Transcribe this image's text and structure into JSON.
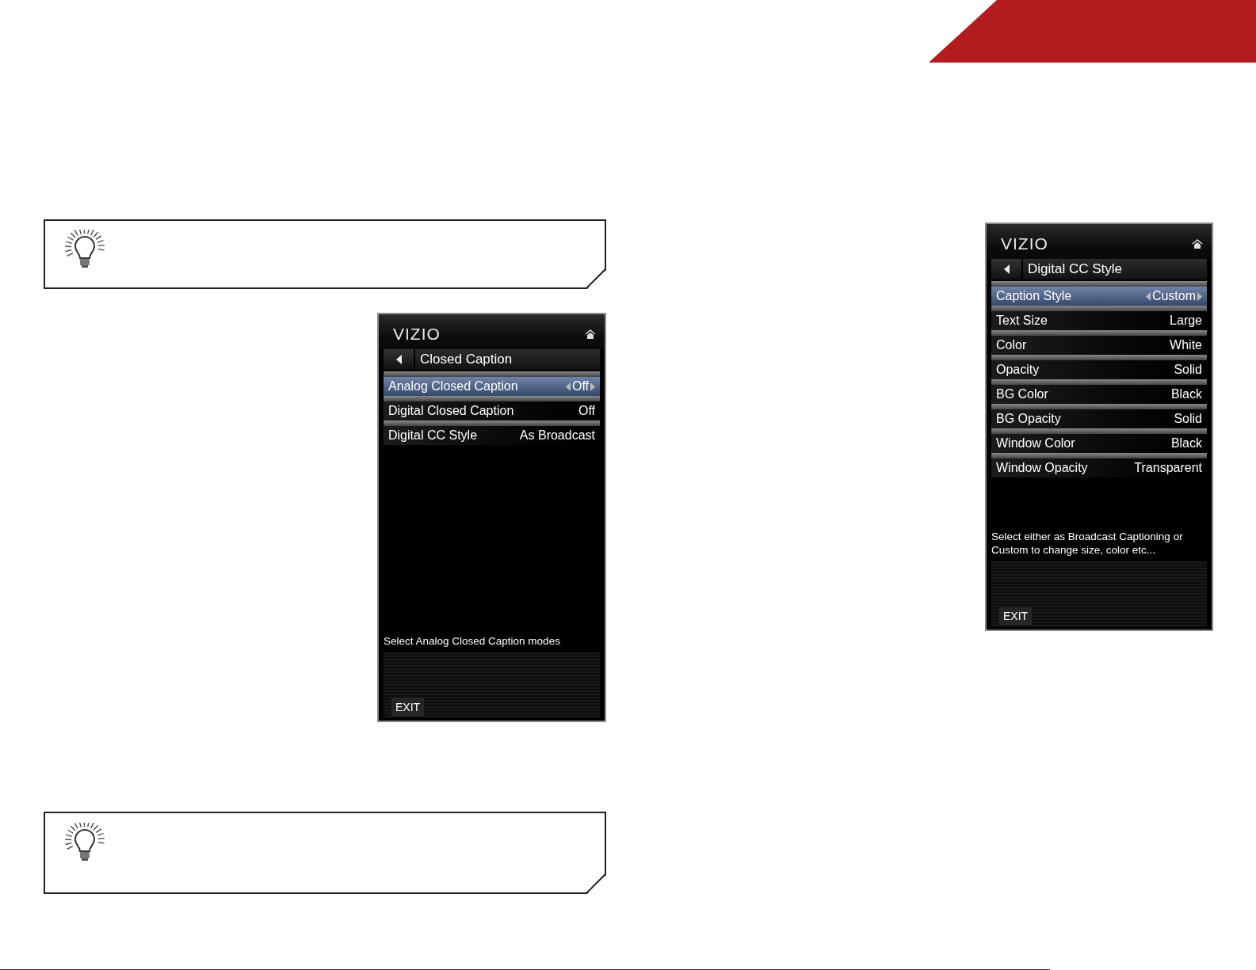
{
  "screens": [
    {
      "logo": "VIZIO",
      "title": "Closed Caption",
      "items": [
        {
          "label": "Analog Closed Caption",
          "value": "Off",
          "selected": true
        },
        {
          "label": "Digital Closed Caption",
          "value": "Off",
          "selected": false
        },
        {
          "label": "Digital CC Style",
          "value": "As Broadcast",
          "selected": false
        }
      ],
      "help": "Select Analog Closed Caption modes",
      "exit": "EXIT"
    },
    {
      "logo": "VIZIO",
      "title": "Digital CC Style",
      "items": [
        {
          "label": "Caption Style",
          "value": "Custom",
          "selected": true
        },
        {
          "label": "Text Size",
          "value": "Large",
          "selected": false
        },
        {
          "label": "Color",
          "value": "White",
          "selected": false
        },
        {
          "label": "Opacity",
          "value": "Solid",
          "selected": false
        },
        {
          "label": "BG Color",
          "value": "Black",
          "selected": false
        },
        {
          "label": "BG Opacity",
          "value": "Solid",
          "selected": false
        },
        {
          "label": "Window Color",
          "value": "Black",
          "selected": false
        },
        {
          "label": "Window Opacity",
          "value": "Transparent",
          "selected": false
        }
      ],
      "help": "Select either as Broadcast Captioning or Custom to change size, color etc...",
      "exit": "EXIT"
    }
  ]
}
